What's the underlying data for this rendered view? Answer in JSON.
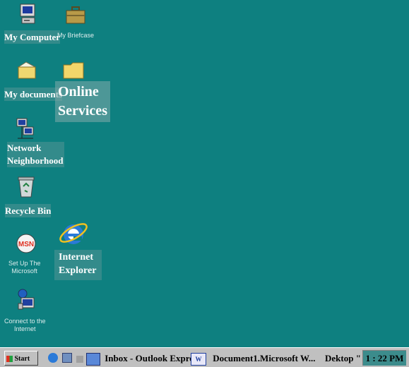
{
  "desktop": {
    "background": "#0e8080",
    "icons": {
      "my_computer": "My Computer",
      "my_briefcase": "My Briefcase",
      "my_documents": "My documents",
      "online_services_line1": "Online",
      "online_services_line2": "Services",
      "network_line1": "Network",
      "network_line2": "Neighborhood",
      "recycle_bin": "Recycle Bin",
      "msn_line1": "Set Up The",
      "msn_line2": "Microsoft",
      "ie_line1": "Internet",
      "ie_line2": "Explorer",
      "connect_line1": "Connect to the",
      "connect_line2": "Internet"
    }
  },
  "taskbar": {
    "start_label": "Start",
    "inbox_label": "Inbox - Outlook Express",
    "word_label": "Document1.Microsoft W...",
    "desktop_toolbar_label": "Dektop",
    "toolbar_chevron": "\"",
    "clock": "1 : 22 PM"
  }
}
